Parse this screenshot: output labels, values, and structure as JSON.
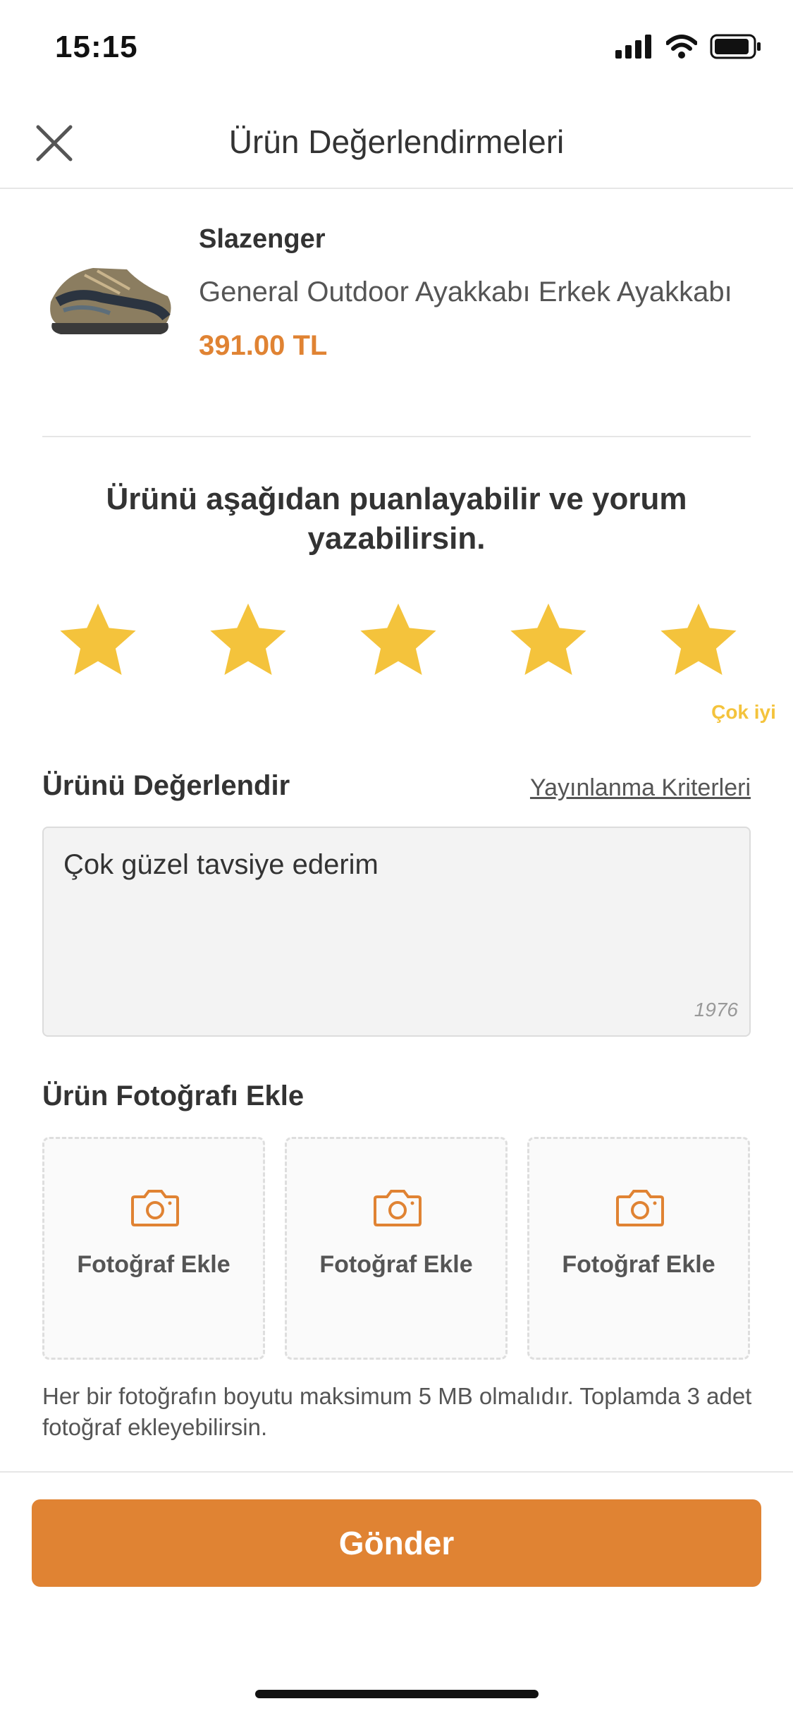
{
  "status_bar": {
    "time": "15:15",
    "icons": [
      "signal-icon",
      "wifi-icon",
      "battery-icon"
    ]
  },
  "header": {
    "title": "Ürün Değerlendirmeleri",
    "close_icon": "close-icon"
  },
  "product": {
    "brand": "Slazenger",
    "name": "General Outdoor Ayakkabı Erkek Ayakkabı",
    "price": "391.00 TL"
  },
  "rating": {
    "prompt": "Ürünü aşağıdan puanlayabilir ve yorum yazabilirsin.",
    "value": 5,
    "max": 5,
    "caption": "Çok iyi",
    "star_color": "#f4c33c"
  },
  "review": {
    "label": "Ürünü Değerlendir",
    "criteria_link": "Yayınlanma Kriterleri",
    "text": "Çok güzel tavsiye ederim",
    "remaining_chars": "1976"
  },
  "photos": {
    "label": "Ürün Fotoğrafı Ekle",
    "slots": [
      {
        "label": "Fotoğraf Ekle"
      },
      {
        "label": "Fotoğraf Ekle"
      },
      {
        "label": "Fotoğraf Ekle"
      }
    ],
    "hint": "Her bir fotoğrafın boyutu maksimum 5 MB olmalıdır. Toplamda 3 adet fotoğraf ekleyebilirsin."
  },
  "submit": {
    "label": "Gönder"
  },
  "colors": {
    "accent": "#e08333",
    "star": "#f4c33c"
  }
}
